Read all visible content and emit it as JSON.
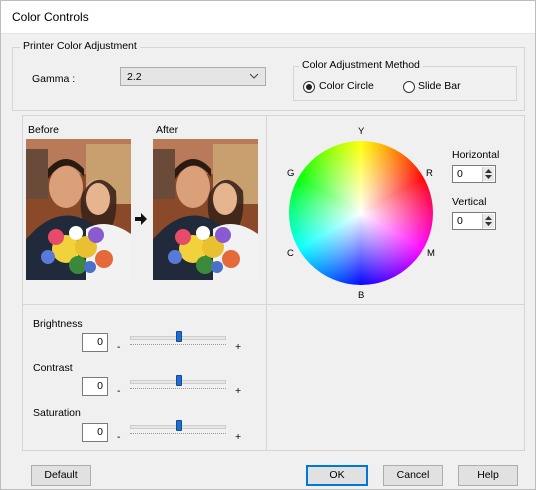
{
  "window": {
    "title": "Color Controls"
  },
  "printer_adjustment": {
    "group_label": "Printer Color Adjustment",
    "gamma_label": "Gamma :",
    "gamma_value": "2.2"
  },
  "method": {
    "group_label": "Color Adjustment Method",
    "options": [
      {
        "label": "Color Circle",
        "selected": true
      },
      {
        "label": "Slide Bar",
        "selected": false
      }
    ]
  },
  "preview": {
    "before_label": "Before",
    "after_label": "After"
  },
  "color_wheel": {
    "labels": {
      "top": "Y",
      "bottom": "B",
      "upper_left": "G",
      "upper_right": "R",
      "lower_left": "C",
      "lower_right": "M"
    }
  },
  "horizontal": {
    "label": "Horizontal",
    "value": "0"
  },
  "vertical": {
    "label": "Vertical",
    "value": "0"
  },
  "sliders": [
    {
      "label": "Brightness",
      "value": "0",
      "min_symbol": "-",
      "max_symbol": "+"
    },
    {
      "label": "Contrast",
      "value": "0",
      "min_symbol": "-",
      "max_symbol": "+"
    },
    {
      "label": "Saturation",
      "value": "0",
      "min_symbol": "-",
      "max_symbol": "+"
    }
  ],
  "buttons": {
    "default": "Default",
    "ok": "OK",
    "cancel": "Cancel",
    "help": "Help"
  },
  "icons": {
    "dropdown": "chevron-down-icon",
    "arrow": "arrow-right-icon",
    "spin_up": "spin-up-icon",
    "spin_down": "spin-down-icon"
  },
  "colors": {
    "accent": "#0078d7",
    "slider_thumb": "#1e6ed0",
    "window_bg": "#f0f0f0"
  }
}
